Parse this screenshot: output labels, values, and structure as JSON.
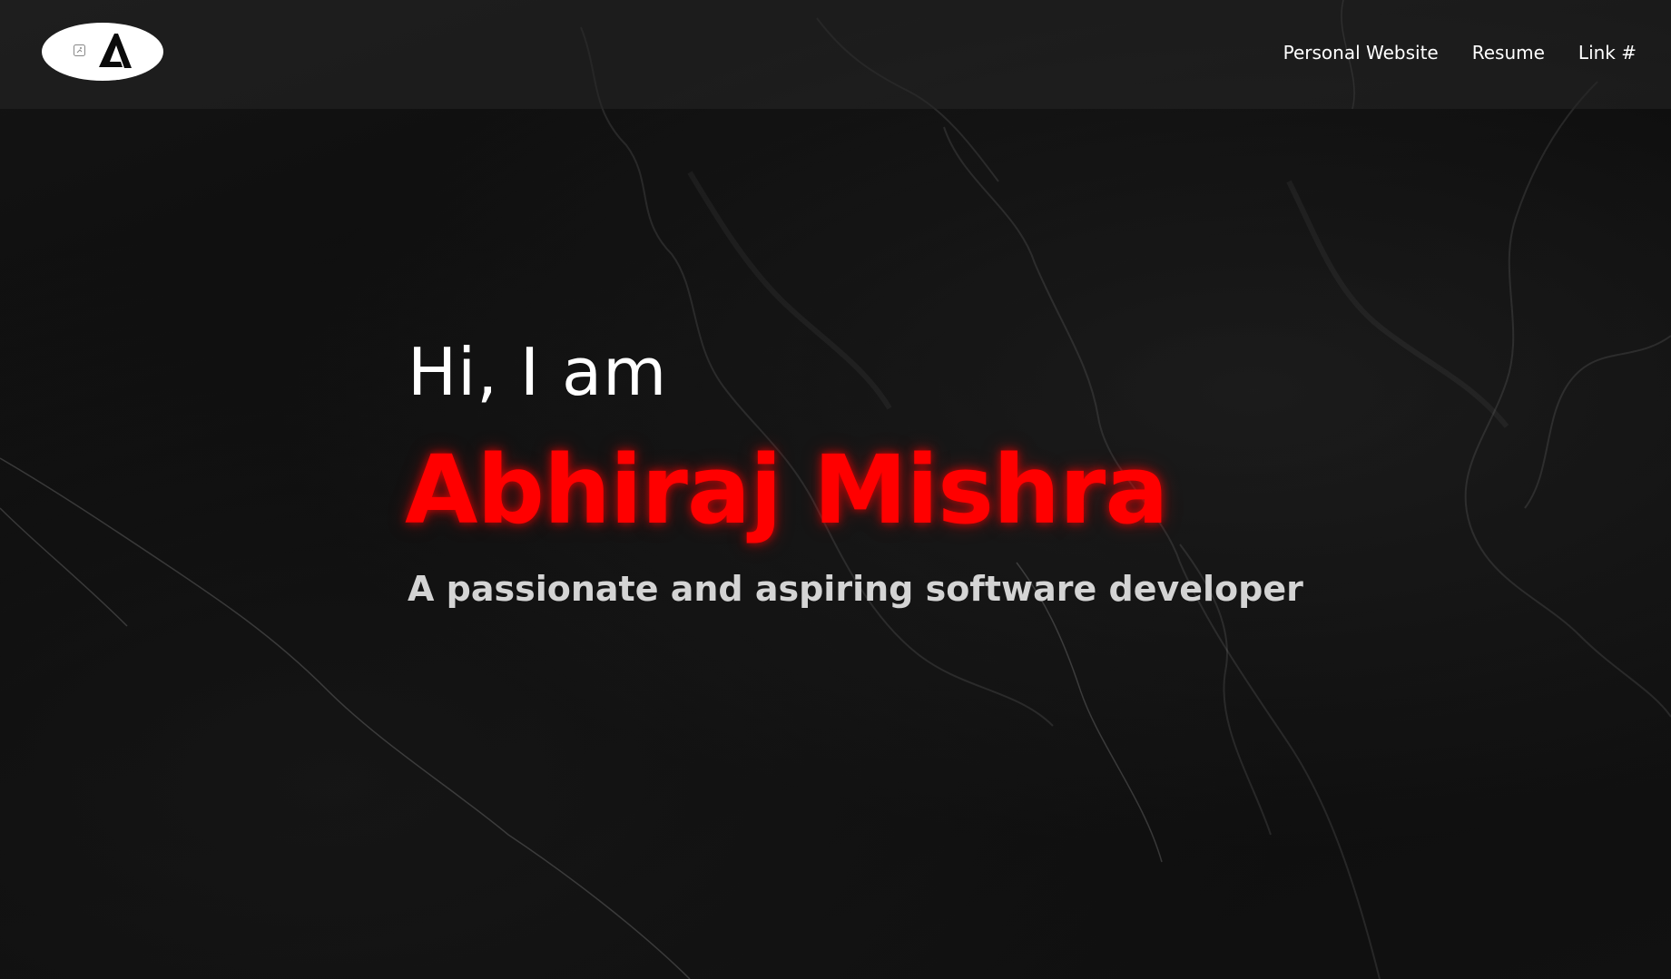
{
  "nav": {
    "logo_icon": "logo-a-icon",
    "links": [
      {
        "label": "Personal Website"
      },
      {
        "label": "Resume"
      },
      {
        "label": "Link #"
      }
    ]
  },
  "hero": {
    "greeting": "Hi, I am",
    "name": "Abhiraj Mishra",
    "tagline": "A passionate and aspiring software developer"
  },
  "colors": {
    "accent": "#ff0000",
    "background": "#0c0c0c",
    "nav_text": "#ffffff",
    "tagline_text": "#d4d4d4"
  }
}
